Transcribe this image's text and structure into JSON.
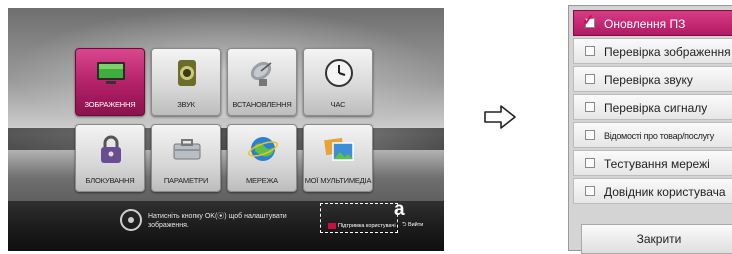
{
  "tv": {
    "tiles": [
      {
        "label": "ЗОБРАЖЕННЯ",
        "icon": "monitor-icon",
        "selected": true
      },
      {
        "label": "ЗВУК",
        "icon": "speaker-icon"
      },
      {
        "label": "ВСТАНОВЛЕННЯ",
        "icon": "satellite-dish-icon"
      },
      {
        "label": "ЧАС",
        "icon": "clock-icon"
      },
      {
        "label": "БЛОКУВАННЯ",
        "icon": "padlock-icon"
      },
      {
        "label": "ПАРАМЕТРИ",
        "icon": "toolbox-icon"
      },
      {
        "label": "МЕРЕЖА",
        "icon": "globe-icon"
      },
      {
        "label": "МОЇ МУЛЬТИМЕДІА",
        "icon": "photos-icon"
      }
    ],
    "hint_text": "Натисніть кнопку OK(⦿) щоб налаштувати зображення.",
    "callout_letter": "a",
    "support_label": "Підтримка користувачі",
    "exit_label": "Вийти"
  },
  "menu": {
    "items": [
      {
        "label": "Оновлення ПЗ",
        "selected": true,
        "checked": true
      },
      {
        "label": "Перевірка зображення"
      },
      {
        "label": "Перевірка звуку"
      },
      {
        "label": "Перевірка сигналу"
      },
      {
        "label": "Відомості про товар/послугу",
        "small": true
      },
      {
        "label": "Тестування мережі"
      },
      {
        "label": "Довідник користувача"
      }
    ],
    "close_label": "Закрити"
  },
  "colors": {
    "accent_magenta": "#b11f66",
    "menu_bg": "#d4d4d4"
  }
}
